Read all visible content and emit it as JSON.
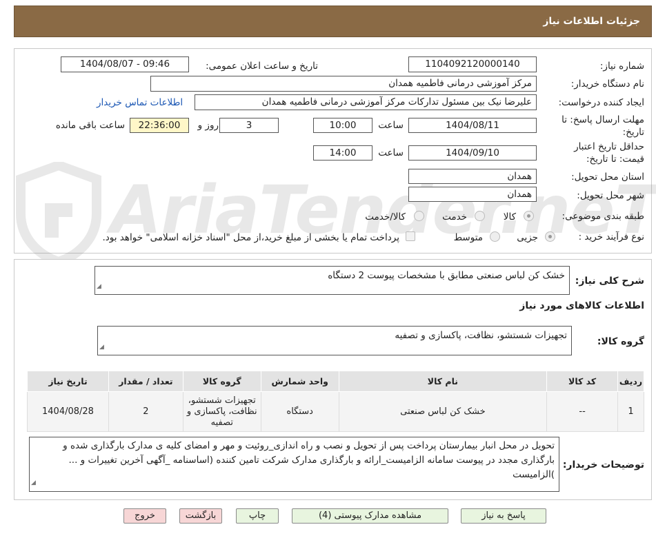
{
  "header": {
    "title": "جزئیات اطلاعات نیاز"
  },
  "form": {
    "need_number_label": "شماره نیاز:",
    "need_number": "1104092120000140",
    "announce_label": "تاریخ و ساعت اعلان عمومی:",
    "announce_value": "1404/08/07 - 09:46",
    "buyer_label": "نام دستگاه خریدار:",
    "buyer_value": "مرکز آموزشی درمانی فاطمیه همدان",
    "creator_label": "ایجاد کننده درخواست:",
    "creator_value": "علیرضا نیک بین مسئول تدارکات مرکز آموزشی درمانی فاطمیه همدان",
    "contact_link": "اطلاعات تماس خریدار",
    "deadline_label_1": "مهلت ارسال پاسخ: تا",
    "deadline_label_2": "تاریخ:",
    "deadline_date": "1404/08/11",
    "time_label": "ساعت",
    "deadline_time": "10:00",
    "days_value": "3",
    "days_label": "روز و",
    "remaining_time": "22:36:00",
    "remaining_label": "ساعت باقی مانده",
    "validity_label_1": "حداقل تاریخ اعتبار",
    "validity_label_2": "قیمت: تا تاریخ:",
    "validity_date": "1404/09/10",
    "validity_time": "14:00",
    "province_label": "استان محل تحویل:",
    "province_value": "همدان",
    "city_label": "شهر محل تحویل:",
    "city_value": "همدان",
    "category_label": "طبقه بندی موضوعی:",
    "category_options": [
      "کالا",
      "خدمت",
      "کالا/خدمت"
    ],
    "process_label": "نوع فرآیند خرید :",
    "process_options": [
      "جزیی",
      "متوسط"
    ],
    "payment_note": "پرداخت تمام یا بخشی از مبلغ خرید،از محل \"اسناد خزانه اسلامی\" خواهد بود."
  },
  "summary": {
    "label": "شرح کلی نیاز:",
    "value": "خشک کن لباس صنعتی مطابق با مشخصات پیوست     2 دستگاه",
    "goods_info_title": "اطلاعات کالاهای مورد نیاز",
    "group_label": "گروه کالا:",
    "group_value": "تجهیزات شستشو، نظافت، پاکسازی و تصفیه"
  },
  "table": {
    "headers": [
      "ردیف",
      "کد کالا",
      "نام کالا",
      "واحد شمارش",
      "گروه کالا",
      "تعداد / مقدار",
      "تاریخ نیاز"
    ],
    "rows": [
      [
        "1",
        "--",
        "خشک کن لباس صنعتی",
        "دستگاه",
        "تجهیزات شستشو، نظافت، پاکسازی و تصفیه",
        "2",
        "1404/08/28"
      ]
    ]
  },
  "buyer_notes": {
    "label": "توضیحات خریدار:",
    "value": "تحویل در محل انبار بیمارستان پرداخت پس از تحویل و نصب و راه اندازی_روئیت و مهر و امضای کلیه ی مدارک بارگذاری شده و بارگذاری مجدد در پیوست سامانه الزامیست_ارائه و بارگذاری مدارک شرکت تامین کننده (اساسنامه _آگهی آخرین تغییرات و ... )الزامیست"
  },
  "buttons": {
    "reply": "پاسخ به نیاز",
    "attachments": "مشاهده مدارک پیوستی (4)",
    "print": "چاپ",
    "back": "بازگشت",
    "exit": "خروج"
  },
  "watermark": "AriaTender.neT",
  "colors": {
    "header": "#8a6a45",
    "link": "#1a56b3",
    "button_green": "#e8f5df",
    "button_red": "#f7d6d6",
    "yellow_field": "#fff7c8"
  }
}
